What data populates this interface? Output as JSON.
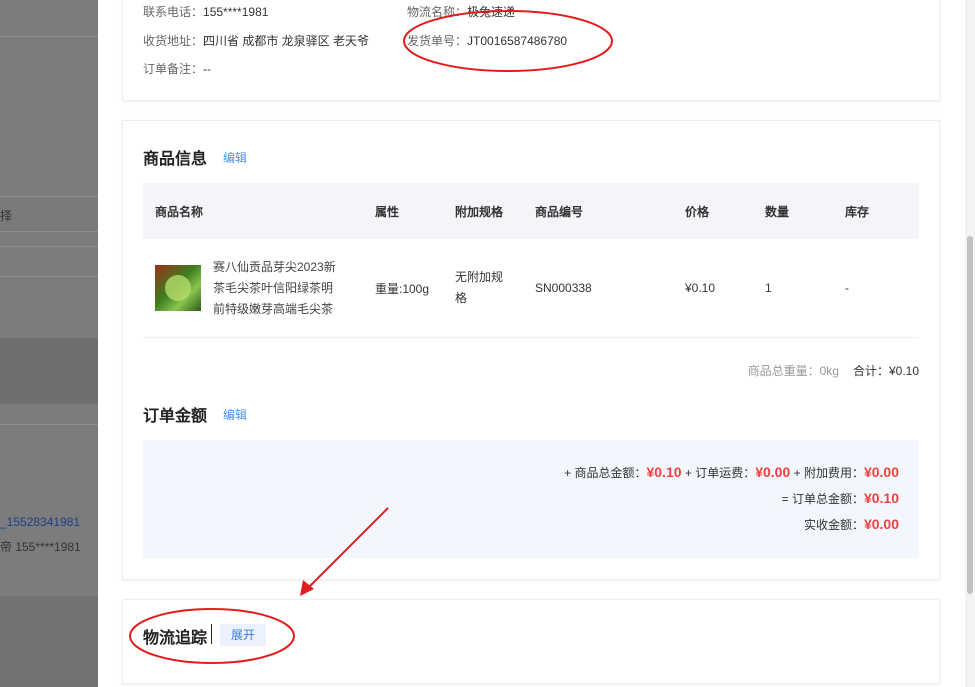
{
  "background": {
    "select_hint": "择",
    "link_text": "_15528341981",
    "phone_row": "帝  155****1981"
  },
  "receiver": {
    "phone_label": "联系电话：",
    "phone_value": "155****1981",
    "address_label": "收货地址：",
    "address_value": "四川省 成都市 龙泉驿区 老天爷",
    "remark_label": "订单备注：",
    "remark_value": "--",
    "logistics_label": "物流名称：",
    "logistics_value": "极兔速递",
    "tracking_label": "发货单号：",
    "tracking_value": "JT0016587486780"
  },
  "goods": {
    "title": "商品信息",
    "edit_label": "编辑",
    "columns": [
      "商品名称",
      "属性",
      "附加规格",
      "商品编号",
      "价格",
      "数量",
      "库存"
    ],
    "rows": [
      {
        "name": "赛八仙贡品芽尖2023新茶毛尖茶叶信阳绿茶明前特级嫩芽高端毛尖茶",
        "attr": "重量:100g",
        "extra": "无附加规格",
        "sku": "SN000338",
        "price": "¥0.10",
        "qty": "1",
        "stock": "-"
      }
    ],
    "total_weight": "商品总重量：0kg",
    "subtotal": "合计：¥0.10"
  },
  "amount": {
    "title": "订单金额",
    "edit_label": "编辑",
    "line1": {
      "goods_label": "+ 商品总金额：",
      "goods_value": "¥0.10",
      "freight_label": " + 订单运费：",
      "freight_value": "¥0.00",
      "extra_label": " + 附加费用：",
      "extra_value": "¥0.00"
    },
    "line2": {
      "label": "= 订单总金额：",
      "value": "¥0.10"
    },
    "line3": {
      "label": "实收金额：",
      "value": "¥0.00"
    }
  },
  "logistics_tracking": {
    "title": "物流追踪",
    "expand_label": "展开"
  },
  "colors": {
    "accent": "#4c8ff0",
    "price_red": "#f04141",
    "annotation": "#e11d1d"
  }
}
